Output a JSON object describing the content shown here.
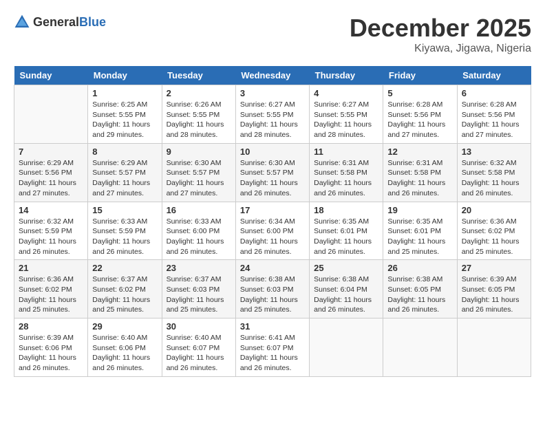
{
  "logo": {
    "text_general": "General",
    "text_blue": "Blue"
  },
  "title": {
    "month_year": "December 2025",
    "location": "Kiyawa, Jigawa, Nigeria"
  },
  "days_of_week": [
    "Sunday",
    "Monday",
    "Tuesday",
    "Wednesday",
    "Thursday",
    "Friday",
    "Saturday"
  ],
  "weeks": [
    [
      {
        "day": "",
        "sunrise": "",
        "sunset": "",
        "daylight": ""
      },
      {
        "day": "1",
        "sunrise": "Sunrise: 6:25 AM",
        "sunset": "Sunset: 5:55 PM",
        "daylight": "Daylight: 11 hours and 29 minutes."
      },
      {
        "day": "2",
        "sunrise": "Sunrise: 6:26 AM",
        "sunset": "Sunset: 5:55 PM",
        "daylight": "Daylight: 11 hours and 28 minutes."
      },
      {
        "day": "3",
        "sunrise": "Sunrise: 6:27 AM",
        "sunset": "Sunset: 5:55 PM",
        "daylight": "Daylight: 11 hours and 28 minutes."
      },
      {
        "day": "4",
        "sunrise": "Sunrise: 6:27 AM",
        "sunset": "Sunset: 5:55 PM",
        "daylight": "Daylight: 11 hours and 28 minutes."
      },
      {
        "day": "5",
        "sunrise": "Sunrise: 6:28 AM",
        "sunset": "Sunset: 5:56 PM",
        "daylight": "Daylight: 11 hours and 27 minutes."
      },
      {
        "day": "6",
        "sunrise": "Sunrise: 6:28 AM",
        "sunset": "Sunset: 5:56 PM",
        "daylight": "Daylight: 11 hours and 27 minutes."
      }
    ],
    [
      {
        "day": "7",
        "sunrise": "Sunrise: 6:29 AM",
        "sunset": "Sunset: 5:56 PM",
        "daylight": "Daylight: 11 hours and 27 minutes."
      },
      {
        "day": "8",
        "sunrise": "Sunrise: 6:29 AM",
        "sunset": "Sunset: 5:57 PM",
        "daylight": "Daylight: 11 hours and 27 minutes."
      },
      {
        "day": "9",
        "sunrise": "Sunrise: 6:30 AM",
        "sunset": "Sunset: 5:57 PM",
        "daylight": "Daylight: 11 hours and 27 minutes."
      },
      {
        "day": "10",
        "sunrise": "Sunrise: 6:30 AM",
        "sunset": "Sunset: 5:57 PM",
        "daylight": "Daylight: 11 hours and 26 minutes."
      },
      {
        "day": "11",
        "sunrise": "Sunrise: 6:31 AM",
        "sunset": "Sunset: 5:58 PM",
        "daylight": "Daylight: 11 hours and 26 minutes."
      },
      {
        "day": "12",
        "sunrise": "Sunrise: 6:31 AM",
        "sunset": "Sunset: 5:58 PM",
        "daylight": "Daylight: 11 hours and 26 minutes."
      },
      {
        "day": "13",
        "sunrise": "Sunrise: 6:32 AM",
        "sunset": "Sunset: 5:58 PM",
        "daylight": "Daylight: 11 hours and 26 minutes."
      }
    ],
    [
      {
        "day": "14",
        "sunrise": "Sunrise: 6:32 AM",
        "sunset": "Sunset: 5:59 PM",
        "daylight": "Daylight: 11 hours and 26 minutes."
      },
      {
        "day": "15",
        "sunrise": "Sunrise: 6:33 AM",
        "sunset": "Sunset: 5:59 PM",
        "daylight": "Daylight: 11 hours and 26 minutes."
      },
      {
        "day": "16",
        "sunrise": "Sunrise: 6:33 AM",
        "sunset": "Sunset: 6:00 PM",
        "daylight": "Daylight: 11 hours and 26 minutes."
      },
      {
        "day": "17",
        "sunrise": "Sunrise: 6:34 AM",
        "sunset": "Sunset: 6:00 PM",
        "daylight": "Daylight: 11 hours and 26 minutes."
      },
      {
        "day": "18",
        "sunrise": "Sunrise: 6:35 AM",
        "sunset": "Sunset: 6:01 PM",
        "daylight": "Daylight: 11 hours and 26 minutes."
      },
      {
        "day": "19",
        "sunrise": "Sunrise: 6:35 AM",
        "sunset": "Sunset: 6:01 PM",
        "daylight": "Daylight: 11 hours and 25 minutes."
      },
      {
        "day": "20",
        "sunrise": "Sunrise: 6:36 AM",
        "sunset": "Sunset: 6:02 PM",
        "daylight": "Daylight: 11 hours and 25 minutes."
      }
    ],
    [
      {
        "day": "21",
        "sunrise": "Sunrise: 6:36 AM",
        "sunset": "Sunset: 6:02 PM",
        "daylight": "Daylight: 11 hours and 25 minutes."
      },
      {
        "day": "22",
        "sunrise": "Sunrise: 6:37 AM",
        "sunset": "Sunset: 6:02 PM",
        "daylight": "Daylight: 11 hours and 25 minutes."
      },
      {
        "day": "23",
        "sunrise": "Sunrise: 6:37 AM",
        "sunset": "Sunset: 6:03 PM",
        "daylight": "Daylight: 11 hours and 25 minutes."
      },
      {
        "day": "24",
        "sunrise": "Sunrise: 6:38 AM",
        "sunset": "Sunset: 6:03 PM",
        "daylight": "Daylight: 11 hours and 25 minutes."
      },
      {
        "day": "25",
        "sunrise": "Sunrise: 6:38 AM",
        "sunset": "Sunset: 6:04 PM",
        "daylight": "Daylight: 11 hours and 26 minutes."
      },
      {
        "day": "26",
        "sunrise": "Sunrise: 6:38 AM",
        "sunset": "Sunset: 6:05 PM",
        "daylight": "Daylight: 11 hours and 26 minutes."
      },
      {
        "day": "27",
        "sunrise": "Sunrise: 6:39 AM",
        "sunset": "Sunset: 6:05 PM",
        "daylight": "Daylight: 11 hours and 26 minutes."
      }
    ],
    [
      {
        "day": "28",
        "sunrise": "Sunrise: 6:39 AM",
        "sunset": "Sunset: 6:06 PM",
        "daylight": "Daylight: 11 hours and 26 minutes."
      },
      {
        "day": "29",
        "sunrise": "Sunrise: 6:40 AM",
        "sunset": "Sunset: 6:06 PM",
        "daylight": "Daylight: 11 hours and 26 minutes."
      },
      {
        "day": "30",
        "sunrise": "Sunrise: 6:40 AM",
        "sunset": "Sunset: 6:07 PM",
        "daylight": "Daylight: 11 hours and 26 minutes."
      },
      {
        "day": "31",
        "sunrise": "Sunrise: 6:41 AM",
        "sunset": "Sunset: 6:07 PM",
        "daylight": "Daylight: 11 hours and 26 minutes."
      },
      {
        "day": "",
        "sunrise": "",
        "sunset": "",
        "daylight": ""
      },
      {
        "day": "",
        "sunrise": "",
        "sunset": "",
        "daylight": ""
      },
      {
        "day": "",
        "sunrise": "",
        "sunset": "",
        "daylight": ""
      }
    ]
  ]
}
